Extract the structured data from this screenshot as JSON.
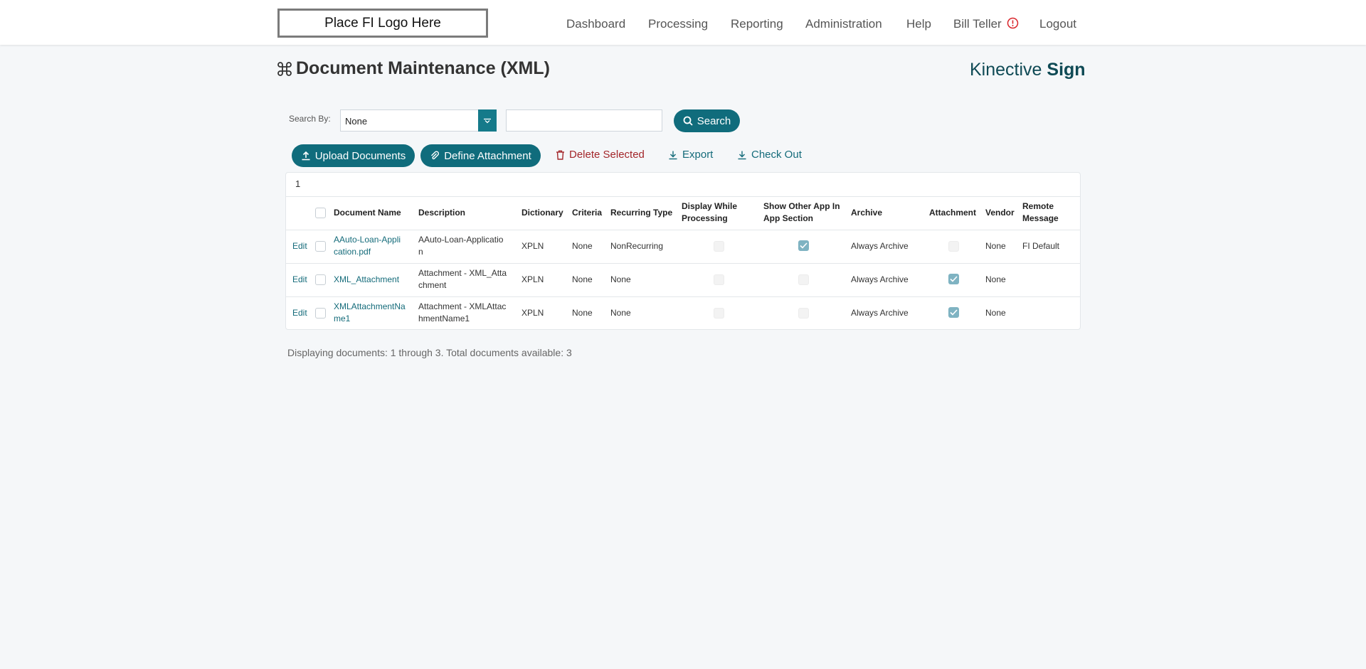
{
  "header": {
    "logo_text": "Place FI Logo Here",
    "nav": {
      "dashboard": "Dashboard",
      "processing": "Processing",
      "reporting": "Reporting",
      "administration": "Administration",
      "help": "Help",
      "user": "Bill Teller",
      "logout": "Logout"
    }
  },
  "page": {
    "title": "Document Maintenance (XML)",
    "brand_light": "Kinective ",
    "brand_bold": "Sign"
  },
  "search": {
    "label": "Search By:",
    "selected": "None",
    "query": "",
    "button": "Search"
  },
  "toolbar": {
    "upload": "Upload Documents",
    "define_attachment": "Define Attachment",
    "delete_selected": "Delete Selected",
    "export": "Export",
    "check_out": "Check Out"
  },
  "table": {
    "page_number": "1",
    "headers": {
      "document_name": "Document Name",
      "description": "Description",
      "dictionary": "Dictionary",
      "criteria": "Criteria",
      "recurring_type": "Recurring Type",
      "display_while_processing_1": "Display While",
      "display_while_processing_2": "Processing",
      "show_other_1": "Show Other App In",
      "show_other_2": "App Section",
      "archive": "Archive",
      "attachment": "Attachment",
      "vendor": "Vendor",
      "remote_message_1": "Remote",
      "remote_message_2": "Message"
    },
    "rows": [
      {
        "edit": "Edit",
        "name_1": "AAuto-Loan-Appli",
        "name_2": "cation.pdf",
        "desc_1": "AAuto-Loan-Applicatio",
        "desc_2": "n",
        "dictionary": "XPLN",
        "criteria": "None",
        "recurring_type": "NonRecurring",
        "display_while_processing": false,
        "show_other_app": true,
        "archive": "Always Archive",
        "attachment": false,
        "vendor": "None",
        "remote_message": "FI Default"
      },
      {
        "edit": "Edit",
        "name_1": "XML_Attachment",
        "name_2": "",
        "desc_1": "Attachment - XML_Atta",
        "desc_2": "chment",
        "dictionary": "XPLN",
        "criteria": "None",
        "recurring_type": "None",
        "display_while_processing": false,
        "show_other_app": false,
        "archive": "Always Archive",
        "attachment": true,
        "vendor": "None",
        "remote_message": ""
      },
      {
        "edit": "Edit",
        "name_1": "XMLAttachmentNa",
        "name_2": "me1",
        "desc_1": "Attachment - XMLAttac",
        "desc_2": "hmentName1",
        "dictionary": "XPLN",
        "criteria": "None",
        "recurring_type": "None",
        "display_while_processing": false,
        "show_other_app": false,
        "archive": "Always Archive",
        "attachment": true,
        "vendor": "None",
        "remote_message": ""
      }
    ]
  },
  "footer": {
    "status": "Displaying documents: 1 through 3. Total documents available: 3"
  },
  "icons": {
    "title": "command-icon",
    "user_alert": "alert-circle-icon",
    "search": "magnifier-icon",
    "upload": "upload-icon",
    "attachment": "paperclip-icon",
    "delete": "trash-icon",
    "export": "download-icon",
    "check_out": "download-icon"
  },
  "colors": {
    "accent": "#106c7c",
    "danger": "#a3262a",
    "alert": "#d9262c",
    "checked": "#7fb3c2"
  }
}
